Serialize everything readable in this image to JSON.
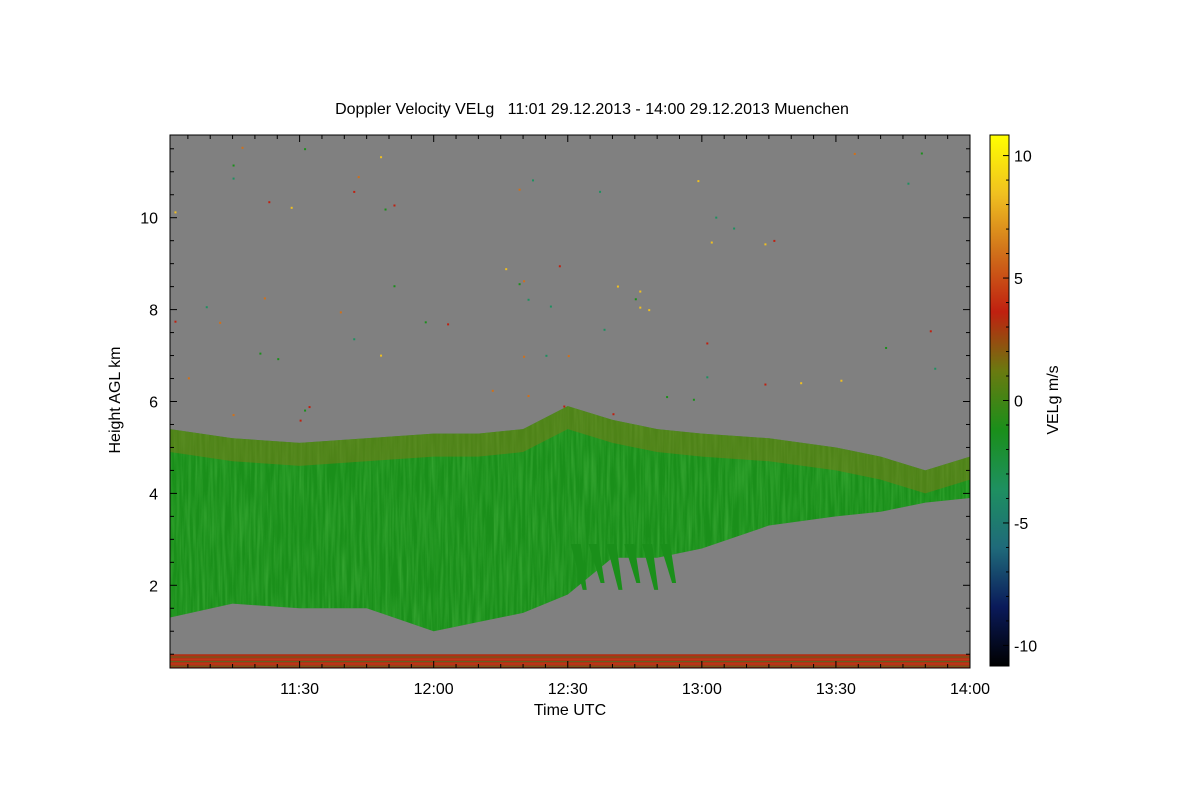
{
  "chart_data": {
    "type": "heatmap",
    "title": "Doppler Velocity VELg   11:01 29.12.2013 - 14:00 29.12.2013 Muenchen",
    "xlabel": "Time UTC",
    "ylabel": "Height AGL km",
    "colorbar_label": "VELg m/s",
    "xlim": [
      "11:01",
      "14:00"
    ],
    "x_ticks": [
      "11:30",
      "12:00",
      "12:30",
      "13:00",
      "13:30",
      "14:00"
    ],
    "ylim": [
      0.2,
      11.8
    ],
    "y_ticks": [
      2,
      4,
      6,
      8,
      10
    ],
    "zlim": [
      -10.8,
      10.8
    ],
    "z_ticks": [
      -10,
      -5,
      0,
      5,
      10
    ],
    "colormap": [
      "#000000",
      "#0a1a5a",
      "#1f6a7a",
      "#1e9060",
      "#1a8f1a",
      "#6a7a10",
      "#c02010",
      "#d0701a",
      "#f0c020",
      "#ffff00"
    ],
    "background_color": "#808080",
    "cloud_layer": {
      "description_values": "Profile of cloud top and base height (km) over time",
      "time": [
        "11:01",
        "11:15",
        "11:30",
        "11:45",
        "12:00",
        "12:10",
        "12:20",
        "12:30",
        "12:40",
        "12:50",
        "13:00",
        "13:15",
        "13:30",
        "13:40",
        "13:50",
        "14:00"
      ],
      "top_km": [
        5.4,
        5.2,
        5.1,
        5.2,
        5.3,
        5.3,
        5.4,
        5.9,
        5.6,
        5.4,
        5.3,
        5.2,
        5.0,
        4.8,
        4.5,
        4.8
      ],
      "base_km": [
        1.3,
        1.6,
        1.5,
        1.5,
        1.0,
        1.2,
        1.4,
        1.8,
        2.6,
        2.6,
        2.8,
        3.3,
        3.5,
        3.6,
        3.8,
        3.9
      ],
      "typical_velocity_ms": -1.5
    },
    "near_surface_band_km": [
      0.2,
      0.5
    ]
  }
}
